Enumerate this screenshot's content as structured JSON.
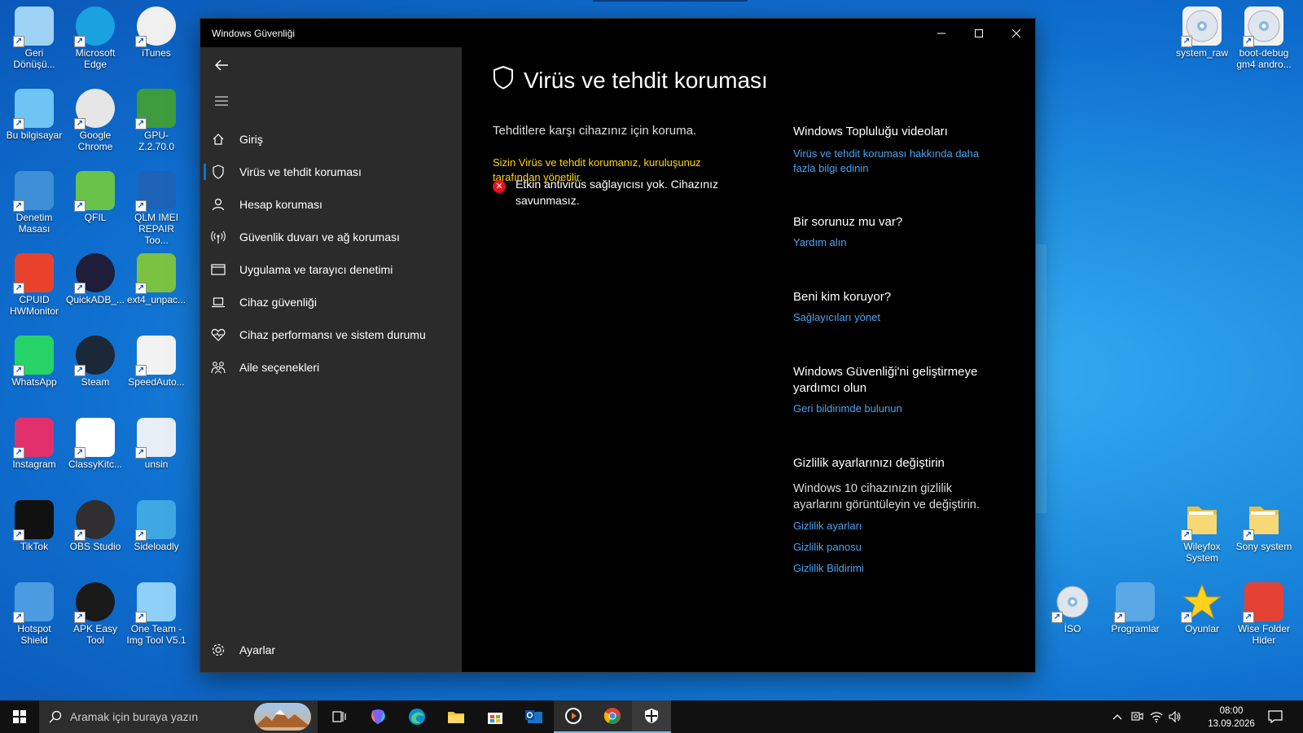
{
  "colors": {
    "accent": "#0078d4",
    "link": "#4ba3f0",
    "warning": "#ffd700",
    "error": "#e81123"
  },
  "desktop_icons": [
    {
      "label": "Geri Dönüşü...",
      "icon": "recycle-bin-icon"
    },
    {
      "label": "Microsoft Edge",
      "icon": "edge-icon"
    },
    {
      "label": "iTunes",
      "icon": "itunes-icon"
    },
    {
      "label": "Bu bilgisayar",
      "icon": "computer-icon"
    },
    {
      "label": "Google Chrome",
      "icon": "chrome-icon"
    },
    {
      "label": "GPU-Z.2.70.0",
      "icon": "gpuz-icon"
    },
    {
      "label": "Denetim Masası",
      "icon": "control-panel-icon"
    },
    {
      "label": "QFIL",
      "icon": "qfil-icon"
    },
    {
      "label": "QLM IMEI REPAIR Too...",
      "icon": "qlm-icon"
    },
    {
      "label": "CPUID HWMonitor",
      "icon": "hwmonitor-icon"
    },
    {
      "label": "QuickADB_...",
      "icon": "quickadb-icon"
    },
    {
      "label": "ext4_unpac...",
      "icon": "android-icon"
    },
    {
      "label": "WhatsApp",
      "icon": "whatsapp-icon"
    },
    {
      "label": "Steam",
      "icon": "steam-icon"
    },
    {
      "label": "SpeedAuto...",
      "icon": "mouse-icon"
    },
    {
      "label": "Instagram",
      "icon": "instagram-icon"
    },
    {
      "label": "ClassyKitc...",
      "icon": "classykitchen-icon"
    },
    {
      "label": "unsin",
      "icon": "unsin-icon"
    },
    {
      "label": "TikTok",
      "icon": "tiktok-icon"
    },
    {
      "label": "OBS Studio",
      "icon": "obs-icon"
    },
    {
      "label": "Sideloadly",
      "icon": "sideloadly-icon"
    },
    {
      "label": "Hotspot Shield",
      "icon": "hotspot-icon"
    },
    {
      "label": "APK Easy Tool",
      "icon": "apk-icon"
    },
    {
      "label": "One Team - Img Tool V5.1",
      "icon": "oneteam-icon"
    },
    {
      "label": "system_raw",
      "icon": "disc-file-icon"
    },
    {
      "label": "boot-debug gm4 andro...",
      "icon": "disc-file-icon"
    },
    {
      "label": "Wileyfox System",
      "icon": "folder-icon"
    },
    {
      "label": "Sony system",
      "icon": "folder-icon"
    },
    {
      "label": "İSO",
      "icon": "cd-icon"
    },
    {
      "label": "Programlar",
      "icon": "programs-icon"
    },
    {
      "label": "Oyunlar",
      "icon": "star-icon"
    },
    {
      "label": "Wise Folder Hider",
      "icon": "wise-icon"
    }
  ],
  "window": {
    "title": "Windows Güvenliği",
    "nav": [
      {
        "label": "Giriş",
        "icon": "home-icon"
      },
      {
        "label": "Virüs ve tehdit koruması",
        "icon": "shield-icon",
        "active": true
      },
      {
        "label": "Hesap koruması",
        "icon": "person-icon"
      },
      {
        "label": "Güvenlik duvarı ve ağ koruması",
        "icon": "wireless-icon"
      },
      {
        "label": "Uygulama ve tarayıcı denetimi",
        "icon": "browser-icon"
      },
      {
        "label": "Cihaz güvenliği",
        "icon": "laptop-icon"
      },
      {
        "label": "Cihaz performansı ve sistem durumu",
        "icon": "heart-icon"
      },
      {
        "label": "Aile seçenekleri",
        "icon": "family-icon"
      }
    ],
    "settings_label": "Ayarlar",
    "main": {
      "title": "Virüs ve tehdit koruması",
      "subtitle": "Tehditlere karşı cihazınız için koruma.",
      "managed_notice": "Sizin Virüs ve tehdit korumanız, kuruluşunuz tarafından yönetilir.",
      "alert": "Etkin antivirüs sağlayıcısı yok. Cihazınız savunmasız."
    },
    "right": {
      "community": {
        "heading": "Windows Topluluğu videoları",
        "link": "Virüs ve tehdit koruması hakkında daha fazla bilgi edinin"
      },
      "question": {
        "heading": "Bir sorunuz mu var?",
        "link": "Yardım alın"
      },
      "who": {
        "heading": "Beni kim koruyor?",
        "link": "Sağlayıcıları yönet"
      },
      "improve": {
        "heading": "Windows Güvenliği'ni geliştirmeye yardımcı olun",
        "link": "Geri bildirimde bulunun"
      },
      "privacy": {
        "heading": "Gizlilik ayarlarınızı değiştirin",
        "text": "Windows 10 cihazınızın gizlilik ayarlarını görüntüleyin ve değiştirin.",
        "links": [
          "Gizlilik ayarları",
          "Gizlilik panosu",
          "Gizlilik Bildirimi"
        ]
      }
    }
  },
  "taskbar": {
    "search_placeholder": "Aramak için buraya yazın",
    "time": "08:00",
    "date": "13.09.2026"
  }
}
